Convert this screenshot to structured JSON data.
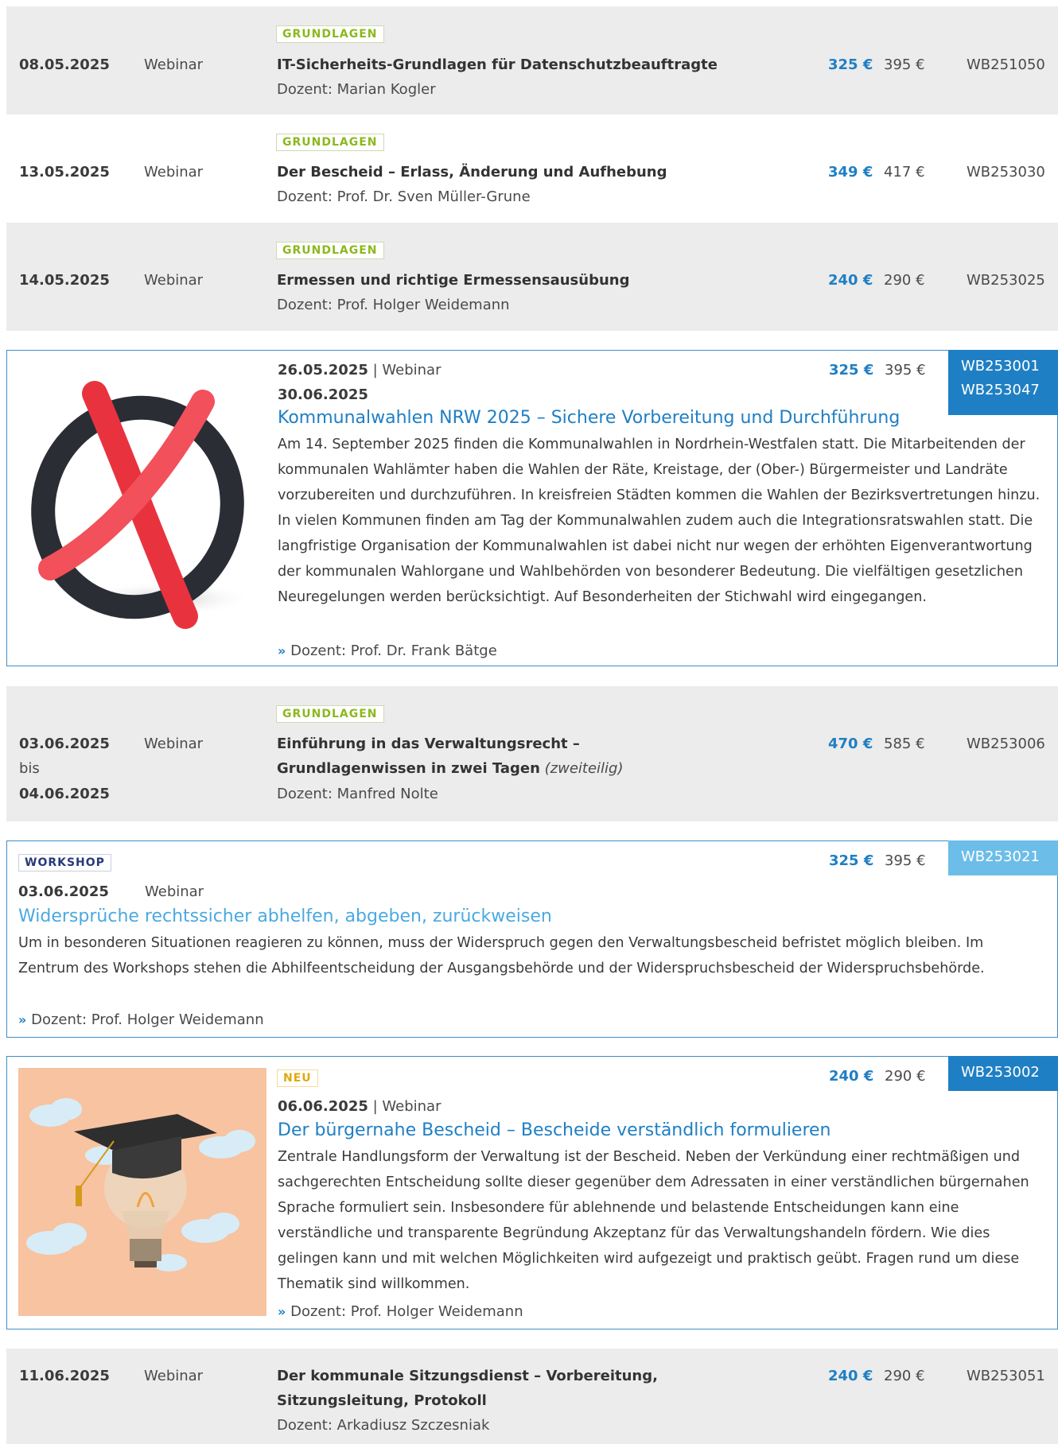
{
  "rows": [
    {
      "tag": "GRUNDLAGEN",
      "date": "08.05.2025",
      "type": "Webinar",
      "title": "IT-Sicherheits-Grundlagen für Datenschutzbeauftragte",
      "lecturer": "Dozent: Marian Kogler",
      "price": "325 €",
      "old_price": "395 €",
      "code": "WB251050"
    },
    {
      "tag": "GRUNDLAGEN",
      "date": "13.05.2025",
      "type": "Webinar",
      "title": "Der Bescheid – Erlass, Änderung und Aufhebung",
      "lecturer": "Dozent: Prof. Dr. Sven Müller-Grune",
      "price": "349 €",
      "old_price": "417 €",
      "code": "WB253030"
    },
    {
      "tag": "GRUNDLAGEN",
      "date": "14.05.2025",
      "type": "Webinar",
      "title": "Ermessen und richtige Ermessensausübung",
      "lecturer": "Dozent: Prof. Holger Weidemann",
      "price": "240 €",
      "old_price": "290 €",
      "code": "WB253025"
    }
  ],
  "card1": {
    "date1": "26.05.2025",
    "sep_type": " | Webinar",
    "date2": "30.06.2025",
    "title": "Kommunalwahlen NRW 2025 – Sichere Vorbereitung und Durchführung",
    "description": "Am 14. September 2025 finden die Kommunalwahlen in Nordrhein-Westfalen statt. Die Mitarbeitenden der kommunalen Wahlämter haben die Wahlen der Räte, Kreistage, der (Ober-) Bürgermeister und Landräte vorzubereiten und durchzuführen. In kreisfreien Städten kommen die Wahlen der Bezirksvertretungen hinzu. In vielen Kommunen finden am Tag der Kommunalwahlen zudem auch die Integrationsratswahlen statt. Die langfristige Organisation der Kommunalwahlen ist dabei nicht nur wegen der erhöhten Eigenverantwortung der kommunalen Wahlorgane und Wahlbehörden von besonderer Bedeutung. Die vielfältigen gesetzlichen Neuregelungen werden berücksichtigt. Auf Besonderheiten der Stichwahl wird eingegangen.",
    "lecturer": "Dozent: Prof. Dr. Frank Bätge",
    "price": "325 €",
    "old_price": "395 €",
    "code1": "WB253001",
    "code2": "WB253047"
  },
  "row4": {
    "tag": "GRUNDLAGEN",
    "date_from": "03.06.2025",
    "until": "bis",
    "date_to": "04.06.2025",
    "type": "Webinar",
    "title_line1": "Einführung in das Verwaltungsrecht –",
    "title_line2": "Grundlagenwissen in zwei Tagen",
    "title_note": "(zweiteilig)",
    "lecturer": "Dozent: Manfred Nolte",
    "price": "470 €",
    "old_price": "585 €",
    "code": "WB253006"
  },
  "card2": {
    "tag": "WORKSHOP",
    "date": "03.06.2025",
    "type": "Webinar",
    "title": "Widersprüche rechtssicher abhelfen, abgeben, zurückweisen",
    "description": "Um in besonderen Situationen reagieren zu können, muss der Widerspruch gegen den Verwaltungsbescheid befristet möglich bleiben. Im Zentrum des Workshops stehen die Abhilfeentscheidung der Ausgangsbehörde und der Widerspruchsbescheid der Widerspruchsbehörde.",
    "lecturer": "Dozent: Prof. Holger Weidemann",
    "price": "325 €",
    "old_price": "395 €",
    "code": "WB253021"
  },
  "card3": {
    "tag": "NEU",
    "date": "06.06.2025",
    "sep_type": " | Webinar",
    "title": "Der bürgernahe Bescheid – Bescheide verständlich formulieren",
    "description": "Zentrale Handlungsform der Verwaltung ist der Bescheid. Neben der Verkündung einer rechtmäßigen und sachgerechten Entscheidung sollte dieser gegenüber dem Adressaten in einer verständlichen bürgernahen Sprache formuliert sein. Insbesondere für ablehnende und belastende Entscheidungen kann eine verständliche und transparente Begründung Akzeptanz für das Verwaltungshandeln fördern. Wie dies gelingen kann und mit welchen Möglichkeiten wird aufgezeigt und praktisch geübt. Fragen rund um diese Thematik sind willkommen.",
    "lecturer": "Dozent: Prof. Holger Weidemann",
    "price": "240 €",
    "old_price": "290 €",
    "code": "WB253002"
  },
  "row5": {
    "date": "11.06.2025",
    "type": "Webinar",
    "title_line1": "Der kommunale Sitzungsdienst – Vorbereitung,",
    "title_line2": "Sitzungsleitung, Protokoll",
    "lecturer": "Dozent: Arkadiusz Szczesniak",
    "price": "240 €",
    "old_price": "290 €",
    "code": "WB253051"
  },
  "arrow_glyph": "»",
  "colors": {
    "accent_blue": "#1f7fc4",
    "light_blue": "#6cbde8",
    "green_tag": "#8cb81e",
    "navy_tag": "#263a78",
    "yellow_tag": "#e0a90b",
    "row_gray": "#ececec"
  }
}
